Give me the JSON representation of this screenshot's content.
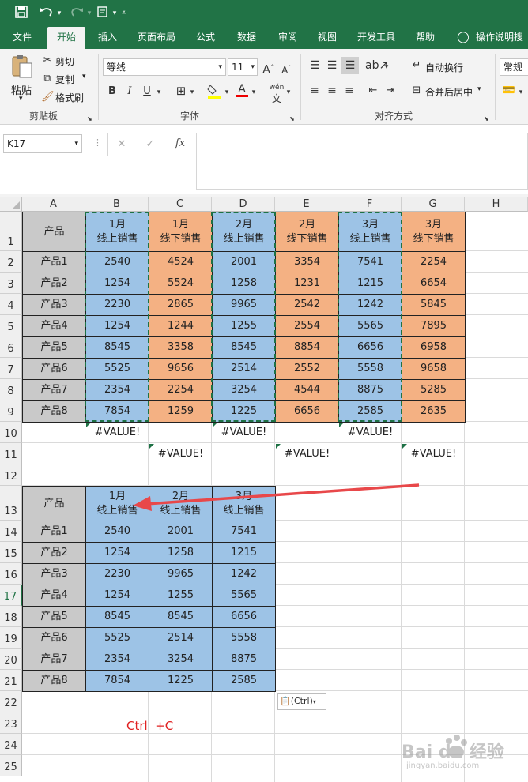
{
  "quick_access": {
    "save": "save-icon",
    "undo": "undo-icon",
    "redo": "redo-icon",
    "print_preview": "print-preview-icon",
    "customize": "customize-icon"
  },
  "tabs": [
    "文件",
    "开始",
    "插入",
    "页面布局",
    "公式",
    "数据",
    "审阅",
    "视图",
    "开发工具",
    "帮助"
  ],
  "tell_me": "操作说明搜",
  "ribbon": {
    "clipboard": {
      "paste": "粘贴",
      "cut": "剪切",
      "copy": "复制",
      "format_painter": "格式刷",
      "group": "剪贴板"
    },
    "font": {
      "name": "等线",
      "size": "11",
      "bold": "B",
      "italic": "I",
      "underline": "U",
      "font_color_letter": "A",
      "phonetic": "wén",
      "grow": "A",
      "shrink": "A",
      "group": "字体"
    },
    "alignment": {
      "wrap": "自动换行",
      "merge": "合并后居中",
      "group": "对齐方式"
    },
    "number": {
      "format": "常规"
    }
  },
  "formula_bar": {
    "name_box": "K17",
    "cancel": "✕",
    "enter": "✓",
    "fx": "fx",
    "content": ""
  },
  "columns": [
    "A",
    "B",
    "C",
    "D",
    "E",
    "F",
    "G",
    "H"
  ],
  "rows": [
    "1",
    "2",
    "3",
    "4",
    "5",
    "6",
    "7",
    "8",
    "9",
    "10",
    "11",
    "12",
    "13",
    "14",
    "15",
    "16",
    "17",
    "18",
    "19",
    "20",
    "21",
    "22",
    "23",
    "24",
    "25"
  ],
  "table1": {
    "corner": "产品",
    "headers": [
      [
        "1月",
        "线上销售"
      ],
      [
        "1月",
        "线下销售"
      ],
      [
        "2月",
        "线上销售"
      ],
      [
        "2月",
        "线下销售"
      ],
      [
        "3月",
        "线上销售"
      ],
      [
        "3月",
        "线下销售"
      ]
    ],
    "products": [
      "产品1",
      "产品2",
      "产品3",
      "产品4",
      "产品5",
      "产品6",
      "产品7",
      "产品8"
    ],
    "values": [
      [
        "2540",
        "4524",
        "2001",
        "3354",
        "7541",
        "2254"
      ],
      [
        "1254",
        "5524",
        "1258",
        "1231",
        "1215",
        "6654"
      ],
      [
        "2230",
        "2865",
        "9965",
        "2542",
        "1242",
        "5845"
      ],
      [
        "1254",
        "1244",
        "1255",
        "2554",
        "5565",
        "7895"
      ],
      [
        "8545",
        "3358",
        "8545",
        "8854",
        "6656",
        "6958"
      ],
      [
        "5525",
        "9656",
        "2514",
        "2552",
        "5558",
        "9658"
      ],
      [
        "2354",
        "2254",
        "3254",
        "4544",
        "8875",
        "5285"
      ],
      [
        "7854",
        "1259",
        "1225",
        "6656",
        "2585",
        "2635"
      ]
    ]
  },
  "errors": {
    "row10": [
      "#VALUE!",
      "#VALUE!",
      "#VALUE!"
    ],
    "row11": [
      "#VALUE!",
      "#VALUE!",
      "#VALUE!"
    ]
  },
  "table2": {
    "corner": "产品",
    "headers": [
      [
        "1月",
        "线上销售"
      ],
      [
        "2月",
        "线上销售"
      ],
      [
        "3月",
        "线上销售"
      ]
    ],
    "products": [
      "产品1",
      "产品2",
      "产品3",
      "产品4",
      "产品5",
      "产品6",
      "产品7",
      "产品8"
    ],
    "values": [
      [
        "2540",
        "2001",
        "7541"
      ],
      [
        "1254",
        "1258",
        "1215"
      ],
      [
        "2230",
        "9965",
        "1242"
      ],
      [
        "1254",
        "1255",
        "5565"
      ],
      [
        "8545",
        "8545",
        "6656"
      ],
      [
        "5525",
        "2514",
        "5558"
      ],
      [
        "2354",
        "3254",
        "8875"
      ],
      [
        "7854",
        "1225",
        "2585"
      ]
    ]
  },
  "paste_options": "(Ctrl)",
  "annotation": "Ctrl  +C",
  "watermark": {
    "main": "Bai du 经验",
    "sub": "jingyan.baidu.com"
  },
  "colors": {
    "excel_green": "#217346",
    "blue_fill": "#9dc3e6",
    "orange_fill": "#f4b183",
    "gray_fill": "#c9c9c9",
    "arrow": "#e8484a"
  }
}
